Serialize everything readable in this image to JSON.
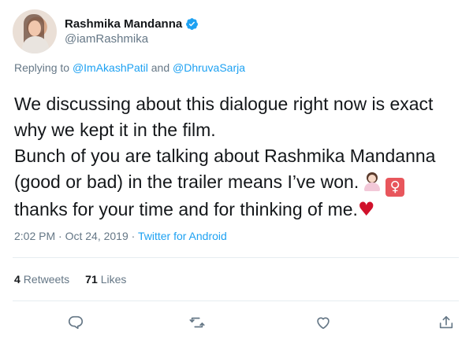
{
  "user": {
    "display_name": "Rashmika Mandanna",
    "handle": "@iamRashmika",
    "verified_icon": "verified-badge-icon",
    "avatar": "profile-photo"
  },
  "replying": {
    "prefix": "Replying to",
    "mention1": "@ImAkashPatil",
    "conjunction": "and",
    "mention2": "@DhruvaSarja"
  },
  "tweet": {
    "lines": [
      "We discussing about this dialogue right now is exact",
      "why we kept it in the film.",
      "Bunch of you are talking about Rashmika Mandanna",
      "(good or bad) in the trailer means I’ve won.",
      " thanks for your time and for thinking of me."
    ],
    "emojis": [
      "person-shrugging-emoji",
      "female-sign-emoji",
      "red-heart-emoji"
    ]
  },
  "meta": {
    "time": "2:02 PM",
    "date": "Oct 24, 2019",
    "separator": "·",
    "source": "Twitter for Android"
  },
  "stats": {
    "retweets_count": "4",
    "retweets_label": "Retweets",
    "likes_count": "71",
    "likes_label": "Likes"
  },
  "actions": [
    "reply-icon",
    "retweet-icon",
    "like-icon",
    "share-icon"
  ],
  "colors": {
    "link": "#1da1f2",
    "secondary_text": "#657786",
    "primary_text": "#14171a",
    "heart": "#d0112b"
  }
}
